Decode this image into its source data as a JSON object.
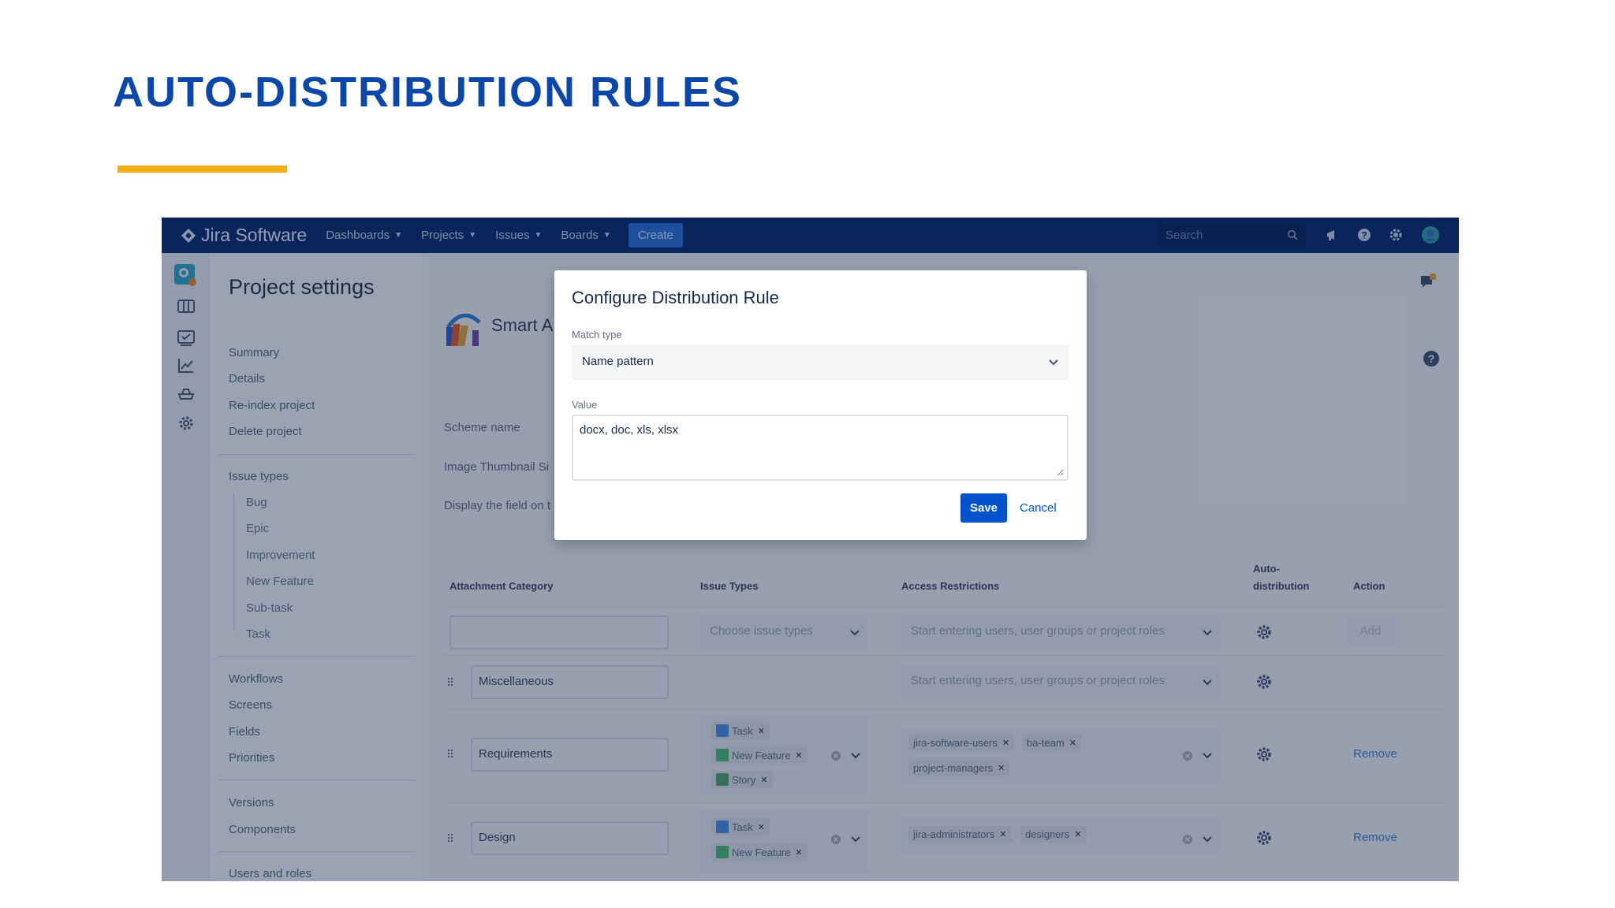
{
  "slide": {
    "title": "AUTO-DISTRIBUTION RULES",
    "accent_color": "#f2b013",
    "title_color": "#0b47a8"
  },
  "topnav": {
    "brand": "Jira Software",
    "items": [
      {
        "label": "Dashboards"
      },
      {
        "label": "Projects"
      },
      {
        "label": "Issues"
      },
      {
        "label": "Boards"
      }
    ],
    "create_label": "Create",
    "search_placeholder": "Search",
    "bg_color": "#0b2a6b"
  },
  "page": {
    "title": "Project settings"
  },
  "sidebar": {
    "group1": [
      "Summary",
      "Details",
      "Re-index project",
      "Delete project"
    ],
    "issue_types_heading": "Issue types",
    "issue_types": [
      "Bug",
      "Epic",
      "Improvement",
      "New Feature",
      "Sub-task",
      "Task"
    ],
    "group3": [
      "Workflows",
      "Screens",
      "Fields",
      "Priorities"
    ],
    "group4": [
      "Versions",
      "Components"
    ],
    "group5": [
      "Users and roles"
    ]
  },
  "main": {
    "app_title": "Smart A",
    "fields": [
      "Scheme name",
      "Image Thumbnail Si",
      "Display the field on t"
    ]
  },
  "table": {
    "headers": {
      "category": "Attachment Category",
      "issue_types": "Issue Types",
      "access": "Access Restrictions",
      "auto_1": "Auto-",
      "auto_2": "distribution",
      "action": "Action"
    },
    "new_row": {
      "category_value": "",
      "issue_types_placeholder": "Choose issue types",
      "access_placeholder": "Start entering users, user groups or project roles",
      "add_label": "Add"
    },
    "rows": [
      {
        "category": "Miscellaneous",
        "access_placeholder": "Start entering users, user groups or project roles"
      },
      {
        "category": "Requirements",
        "issue_types": [
          "Task",
          "New Feature",
          "Story"
        ],
        "access": [
          "jira-software-users",
          "ba-team",
          "project-managers"
        ],
        "action": "Remove"
      },
      {
        "category": "Design",
        "issue_types": [
          "Task",
          "New Feature"
        ],
        "access": [
          "jira-administrators",
          "designers"
        ],
        "action": "Remove"
      }
    ]
  },
  "dialog": {
    "title": "Configure Distribution Rule",
    "match_type_label": "Match type",
    "match_type_value": "Name pattern",
    "value_label": "Value",
    "value_text": "docx, doc, xls, xlsx",
    "save_label": "Save",
    "cancel_label": "Cancel",
    "primary_color": "#0052cc"
  }
}
